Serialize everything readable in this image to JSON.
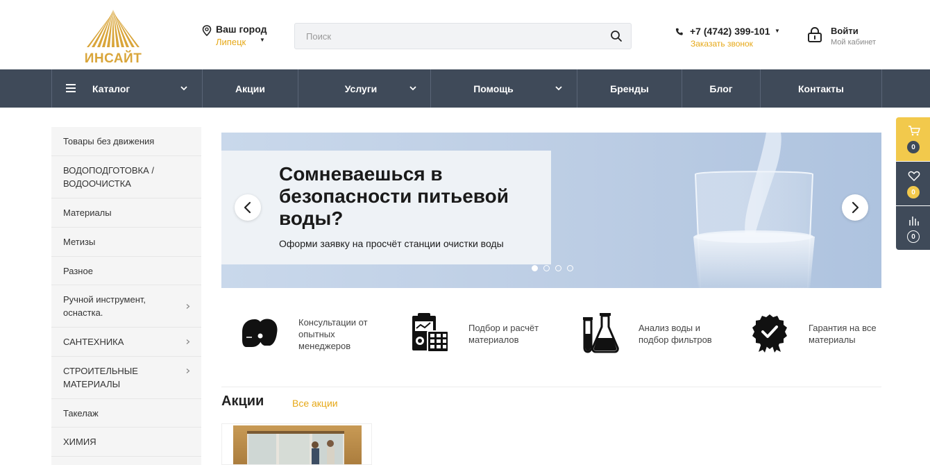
{
  "header": {
    "logo_text": "ИНСАЙТ",
    "city_label": "Ваш город",
    "city_value": "Липецк",
    "search_placeholder": "Поиск",
    "phone": "+7 (4742) 399-101",
    "callback": "Заказать звонок",
    "login_title": "Войти",
    "login_sub": "Мой кабинет"
  },
  "nav": {
    "items": [
      {
        "label": "Каталог",
        "has_dropdown": true
      },
      {
        "label": "Акции",
        "has_dropdown": false
      },
      {
        "label": "Услуги",
        "has_dropdown": true
      },
      {
        "label": "Помощь",
        "has_dropdown": true
      },
      {
        "label": "Бренды",
        "has_dropdown": false
      },
      {
        "label": "Блог",
        "has_dropdown": false
      },
      {
        "label": "Контакты",
        "has_dropdown": false
      }
    ]
  },
  "sidebar": {
    "items": [
      {
        "label": "Товары без движения",
        "has_sub": false
      },
      {
        "label": "ВОДОПОДГОТОВКА / ВОДООЧИСТКА",
        "has_sub": false
      },
      {
        "label": "Материалы",
        "has_sub": false
      },
      {
        "label": "Метизы",
        "has_sub": false
      },
      {
        "label": "Разное",
        "has_sub": false
      },
      {
        "label": "Ручной инструмент, оснастка.",
        "has_sub": true
      },
      {
        "label": "САНТЕХНИКА",
        "has_sub": true
      },
      {
        "label": "СТРОИТЕЛЬНЫЕ МАТЕРИАЛЫ",
        "has_sub": true
      },
      {
        "label": "Такелаж",
        "has_sub": false
      },
      {
        "label": "ХИМИЯ",
        "has_sub": false
      },
      {
        "label": "",
        "has_sub": false
      }
    ]
  },
  "banner": {
    "title": "Сомневаешься в безопасности питьевой воды?",
    "subtitle": "Оформи заявку на просчёт станции очистки воды",
    "slides_total": 4,
    "active_slide": 1
  },
  "features": [
    {
      "icon": "consultation-icon",
      "text": "Консультации от опытных менеджеров"
    },
    {
      "icon": "calculator-icon",
      "text": "Подбор и расчёт материалов"
    },
    {
      "icon": "lab-flask-icon",
      "text": "Анализ воды и подбор фильтров"
    },
    {
      "icon": "guarantee-badge-icon",
      "text": "Гарантия на все материалы"
    }
  ],
  "promo": {
    "title": "Акции",
    "all_link": "Все акции"
  },
  "widget": {
    "cart_count": "0",
    "favorites_count": "0",
    "compare_count": "0"
  },
  "colors": {
    "accent": "#e6a817",
    "nav_bg": "#3f4a59",
    "logo": "#d9a53a"
  }
}
